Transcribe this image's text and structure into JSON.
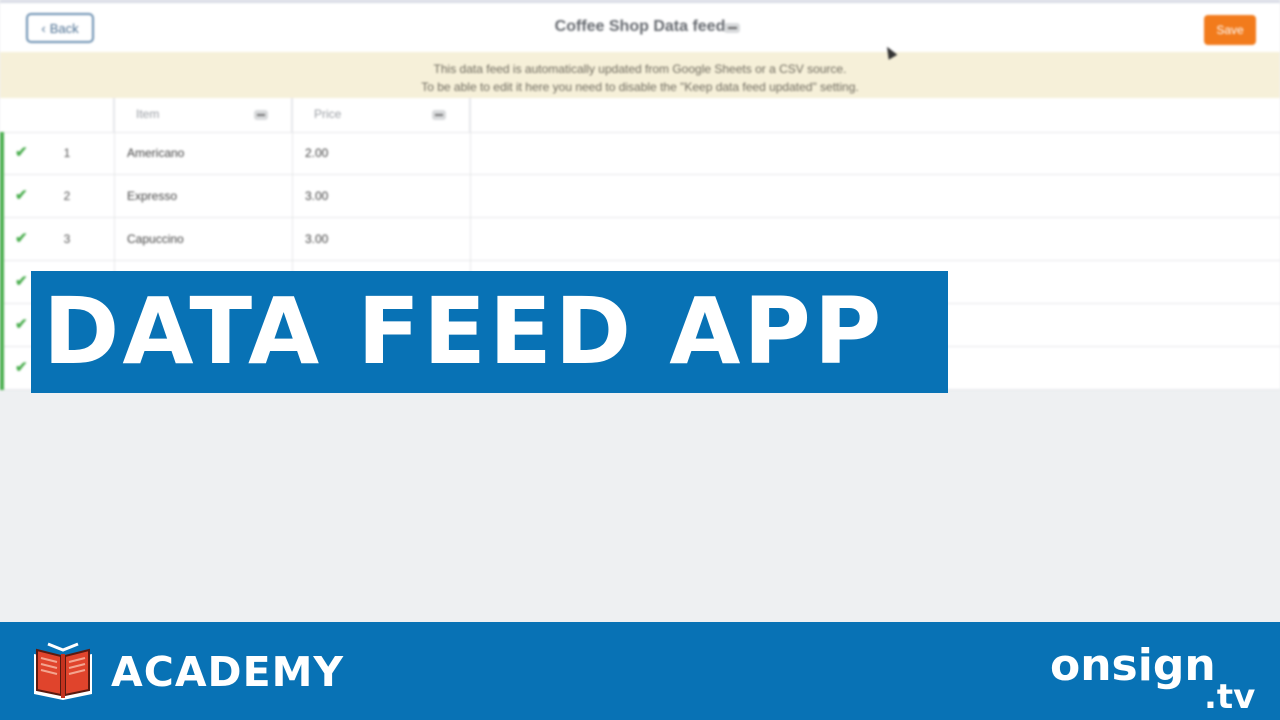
{
  "header": {
    "back_label": "Back",
    "title": "Coffee Shop Data feed",
    "save_label": "Save"
  },
  "notice": {
    "line1": "This data feed is automatically updated from Google Sheets or a CSV source.",
    "line2": "To be able to edit it here you need to disable the \"Keep data feed updated\" setting."
  },
  "table": {
    "columns": [
      "Item",
      "Price"
    ],
    "rows": [
      {
        "num": "1",
        "item": "Americano",
        "price": "2.00"
      },
      {
        "num": "2",
        "item": "Expresso",
        "price": "3.00"
      },
      {
        "num": "3",
        "item": "Capuccino",
        "price": "3.00"
      }
    ]
  },
  "banner": {
    "text": "DATA FEED APP"
  },
  "footer": {
    "academy_label": "ACADEMY",
    "brand": "onsign",
    "brand_suffix": ".tv"
  },
  "colors": {
    "brand_blue": "#0872b5",
    "save_orange": "#f27b1c",
    "row_status_green": "#4caf50",
    "notice_bg": "#f6f0d9"
  },
  "icons": [
    "chevron-left-icon",
    "more-icon",
    "check-icon",
    "book-icon",
    "cursor-icon"
  ]
}
